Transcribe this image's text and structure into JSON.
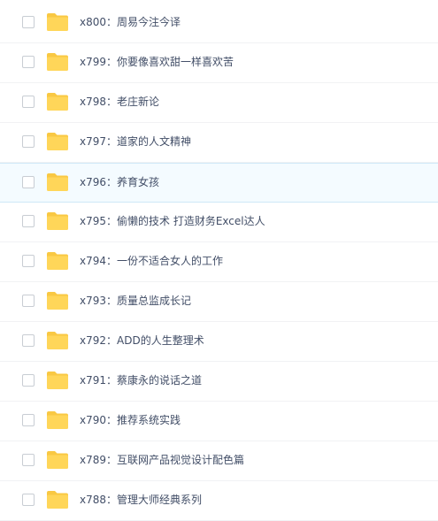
{
  "colors": {
    "folder": "#ffd659",
    "folder_tab": "#f9c843",
    "text": "#424e67",
    "hover_background": "#f4fbff"
  },
  "file_list": {
    "items": [
      {
        "name": "x800：周易今注今译",
        "icon": "folder-icon",
        "checked": false
      },
      {
        "name": "x799：你要像喜欢甜一样喜欢苦",
        "icon": "folder-icon",
        "checked": false
      },
      {
        "name": "x798：老庄新论",
        "icon": "folder-icon",
        "checked": false
      },
      {
        "name": "x797：道家的人文精神",
        "icon": "folder-icon",
        "checked": false
      },
      {
        "name": "x796：养育女孩",
        "icon": "folder-icon",
        "checked": false,
        "hovered": true
      },
      {
        "name": "x795：偷懒的技术 打造财务Excel达人",
        "icon": "folder-icon",
        "checked": false
      },
      {
        "name": "x794：一份不适合女人的工作",
        "icon": "folder-icon",
        "checked": false
      },
      {
        "name": "x793：质量总监成长记",
        "icon": "folder-icon",
        "checked": false
      },
      {
        "name": "x792：ADD的人生整理术",
        "icon": "folder-icon",
        "checked": false
      },
      {
        "name": "x791：蔡康永的说话之道",
        "icon": "folder-icon",
        "checked": false
      },
      {
        "name": "x790：推荐系统实践",
        "icon": "folder-icon",
        "checked": false
      },
      {
        "name": "x789：互联网产品视觉设计配色篇",
        "icon": "folder-icon",
        "checked": false
      },
      {
        "name": "x788：管理大师经典系列",
        "icon": "folder-icon",
        "checked": false
      }
    ]
  }
}
